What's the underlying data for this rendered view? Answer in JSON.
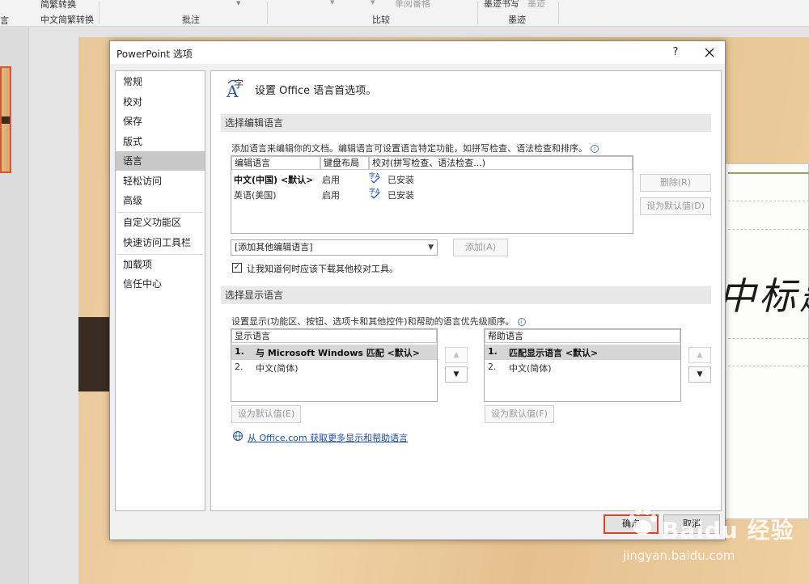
{
  "ribbon": {
    "partial_left": "言",
    "convert_top": "简繁转换",
    "convert_bottom": "中文简繁转换",
    "group_comments": "批注",
    "group_compare_top": "单阅番格",
    "group_compare": "比较",
    "ink_top_1": "墨迹书写",
    "ink_top_2": "墨迹",
    "group_ink": "墨迹"
  },
  "slide": {
    "calligraphy": "中标题"
  },
  "dialog": {
    "title": "PowerPoint 选项",
    "help": "?",
    "nav": [
      "常规",
      "校对",
      "保存",
      "版式",
      "语言",
      "轻松访问",
      "高级",
      "自定义功能区",
      "快速访问工具栏",
      "加载项",
      "信任中心"
    ],
    "selected_nav": "语言",
    "header": "设置 Office 语言首选项。",
    "edit_section": {
      "title": "选择编辑语言",
      "desc": "添加语言来编辑你的文档。编辑语言可设置语言特定功能，如拼写检查、语法检查和排序。",
      "info": "i",
      "columns": [
        "编辑语言",
        "键盘布局",
        "校对(拼写检查、语法检查...)"
      ],
      "rows": [
        {
          "lang": "中文(中国) <默认>",
          "keyboard": "启用",
          "proofing": "已安装"
        },
        {
          "lang": "英语(美国)",
          "keyboard": "启用",
          "proofing": "已安装"
        }
      ],
      "remove_button": "删除(R)",
      "set_default_button": "设为默认值(D)",
      "add_combo": "[添加其他编辑语言]",
      "add_button": "添加(A)",
      "checkbox_label": "让我知道何时应该下载其他校对工具。",
      "checkbox_checked": true
    },
    "display_section": {
      "title": "选择显示语言",
      "desc": "设置显示(功能区、按钮、选项卡和其他控件)和帮助的语言优先级顺序。",
      "info": "i",
      "display_header": "显示语言",
      "display_items": [
        {
          "num": "1.",
          "name": "与 Microsoft Windows 匹配 <默认>"
        },
        {
          "num": "2.",
          "name": "中文(简体)"
        }
      ],
      "help_header": "帮助语言",
      "help_items": [
        {
          "num": "1.",
          "name": "匹配显示语言 <默认>"
        },
        {
          "num": "2.",
          "name": "中文(简体)"
        }
      ],
      "up_arrow": "▲",
      "down_arrow": "▼",
      "display_set_default": "设为默认值(E)",
      "help_set_default": "设为默认值(F)",
      "link": "从 Office.com 获取更多显示和帮助语言"
    },
    "ok": "确定",
    "cancel": "取消"
  },
  "watermark": {
    "brand": "Baidu 经验",
    "url": "jingyan.baidu.com"
  }
}
